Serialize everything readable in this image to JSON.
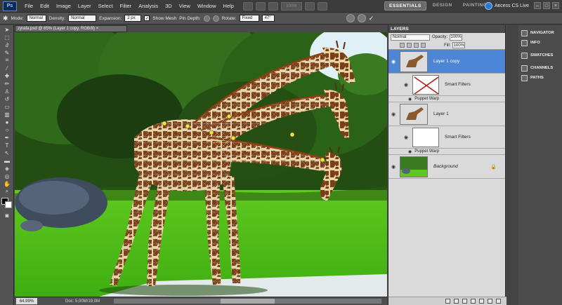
{
  "menubar": {
    "logo": "Ps",
    "items": [
      "File",
      "Edit",
      "Image",
      "Layer",
      "Select",
      "Filter",
      "Analysis",
      "3D",
      "View",
      "Window",
      "Help"
    ],
    "zoom_value": "100%",
    "workspaces": [
      "ESSENTIALS",
      "DESIGN",
      "PAINTING"
    ],
    "cs_live": "Access CS Live"
  },
  "options": {
    "mode_label": "Mode:",
    "mode_value": "Normal",
    "density_label": "Density:",
    "density_value": "Normal",
    "expansion_label": "Expansion:",
    "expansion_value": "2 px",
    "show_mesh_label": "Show Mesh",
    "pin_depth_label": "Pin Depth:",
    "rotate_label": "Rotate:",
    "rotate_value": "Fixed",
    "rotate_angle": "47°"
  },
  "document": {
    "tab_title": "zyrafa.psd @ 65% (Layer 1 copy, RGB/8) ×",
    "zoom": "64.99%",
    "doc_info": "Doc: 5,00M/19,0M"
  },
  "layers_panel": {
    "tab": "LAYERS",
    "blend_mode": "Normal",
    "opacity_label": "Opacity:",
    "opacity_value": "100%",
    "fill_label": "Fill:",
    "fill_value": "100%",
    "layers": [
      {
        "name": "Layer 1 copy",
        "selected": true,
        "smart_filters": "Smart Filters",
        "filter": "Puppet Warp"
      },
      {
        "name": "Layer 1",
        "selected": false,
        "smart_filters": "Smart Filters",
        "filter": "Puppet Warp"
      },
      {
        "name": "Background",
        "selected": false
      }
    ]
  },
  "dock": {
    "items": [
      "NAVIGATOR",
      "INFO",
      "SWATCHES",
      "CHANNELS",
      "PATHS"
    ]
  },
  "colors": {
    "selection": "#4d86d6",
    "panel_bg": "#dadada",
    "ui_dark": "#535353"
  }
}
